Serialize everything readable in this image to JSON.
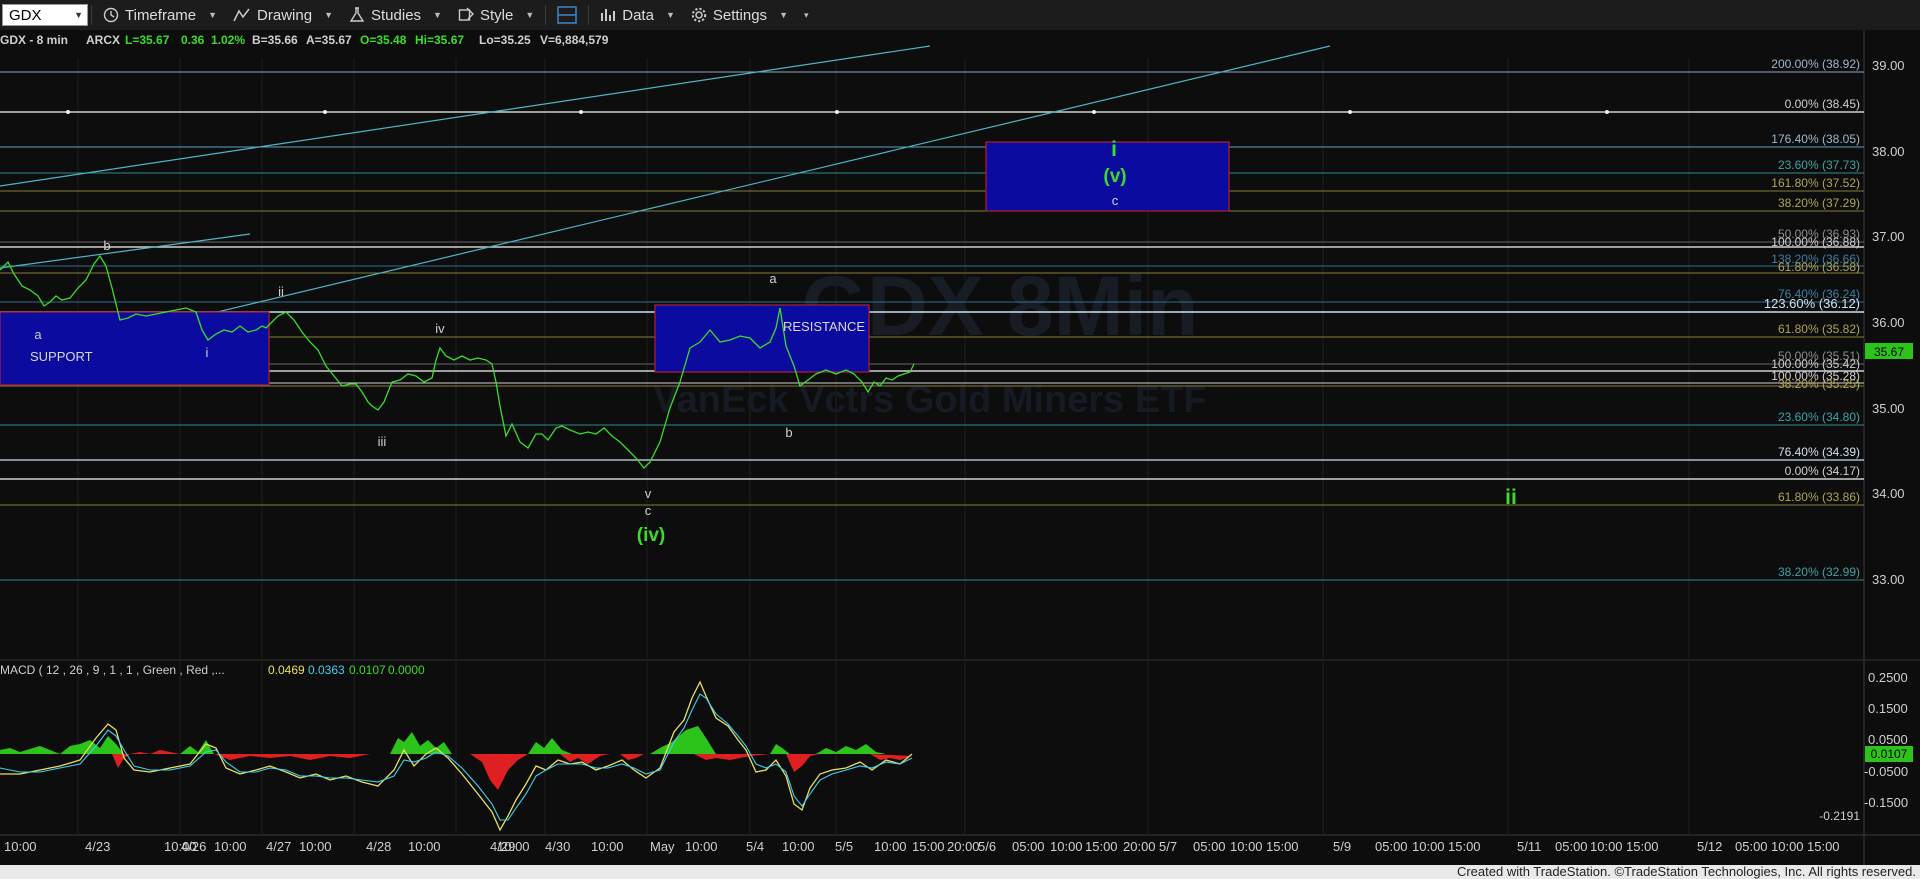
{
  "toolbar": {
    "symbol": "GDX",
    "timeframe": "Timeframe",
    "drawing": "Drawing",
    "studies": "Studies",
    "style": "Style",
    "data": "Data",
    "settings": "Settings"
  },
  "chart_header": {
    "symbol": "GDX - 8 min",
    "exchange": "ARCX",
    "last": "L=35.67",
    "change": "0.36",
    "change_pct": "1.02%",
    "bid": "B=35.66",
    "ask": "A=35.67",
    "open": "O=35.48",
    "high": "Hi=35.67",
    "low": "Lo=35.25",
    "volume": "V=6,884,579"
  },
  "watermark": {
    "line1": "GDX 8Min",
    "line2": "VanEck Vctrs Gold Miners ETF"
  },
  "price_axis": {
    "ticks": [
      "39.00",
      "38.00",
      "37.00",
      "36.00",
      "35.00",
      "34.00",
      "33.00"
    ],
    "current_price": "35.67"
  },
  "fib_labels": [
    {
      "text": "200.00% (38.92)",
      "color": "#9fb6cc"
    },
    {
      "text": "0.00% (38.45)",
      "color": "#cfcfcf"
    },
    {
      "text": "176.40% (38.05)",
      "color": "#9fb6cc"
    },
    {
      "text": "23.60% (37.73)",
      "color": "#3fa3a3"
    },
    {
      "text": "161.80% (37.52)",
      "color": "#b0a552"
    },
    {
      "text": "38.20% (37.29)",
      "color": "#b0a552"
    },
    {
      "text": "50.00% (36.93)",
      "color": "#8c8c8c"
    },
    {
      "text": "100.00% (36.88)",
      "color": "#cfcfcf"
    },
    {
      "text": "138.20% (36.66)",
      "color": "#3f7fa0"
    },
    {
      "text": "61.80% (36.58)",
      "color": "#b0a552"
    },
    {
      "text": "76.40% (36.24)",
      "color": "#3f7fa0"
    },
    {
      "text": "123.60% (36.12)",
      "color": "#cfe0ee"
    },
    {
      "text": "61.80% (35.82)",
      "color": "#b0a552"
    },
    {
      "text": "50.00% (35.51)",
      "color": "#8c8c8c"
    },
    {
      "text": "100.00% (35.42)",
      "color": "#cfcfcf"
    },
    {
      "text": "100.00% (35.28)",
      "color": "#cfcfcf"
    },
    {
      "text": "38.20% (35.25)",
      "color": "#b0a552"
    },
    {
      "text": "23.60% (34.80)",
      "color": "#3fa3a3"
    },
    {
      "text": "76.40% (34.39)",
      "color": "#cfe0ee"
    },
    {
      "text": "0.00% (34.17)",
      "color": "#cfcfcf"
    },
    {
      "text": "61.80% (33.86)",
      "color": "#b0a552"
    },
    {
      "text": "38.20% (32.99)",
      "color": "#3fa3a3"
    }
  ],
  "boxes": {
    "support": "SUPPORT",
    "resistance": "RESISTANCE"
  },
  "wave_labels": {
    "a1": "a",
    "b1": "b",
    "i_small": "i",
    "ii_small": "ii",
    "iii_small": "iii",
    "iv_small": "iv",
    "v_small": "v",
    "c1": "c",
    "iv_paren": "(iv)",
    "a2": "a",
    "b2": "b",
    "i_big": "i",
    "v_paren": "(v)",
    "c2": "c",
    "ii_big": "ii"
  },
  "macd": {
    "label": "MACD ( 12 , 26 , 9 , 1 , 1 , Green , Red ,...",
    "v1": "0.0469",
    "v2": "0.0363",
    "v3": "0.0107",
    "v4": "0.0000",
    "ticks": [
      "0.2500",
      "0.1500",
      "0.0500",
      "-0.0500",
      "-0.1500"
    ],
    "current": "0.0107",
    "low_label": "-0.2191"
  },
  "time_axis": [
    "10:00",
    "4/23",
    "10:00",
    "4/26",
    "10:00",
    "4/27",
    "10:00",
    "4/28",
    "10:00",
    "4/29",
    "10:00",
    "4/30",
    "10:00",
    "May",
    "10:00",
    "5/4",
    "10:00",
    "5/5",
    "10:00",
    "15:00",
    "20:00",
    "5/6",
    "05:00",
    "10:00",
    "15:00",
    "20:00",
    "5/7",
    "05:00",
    "10:00",
    "15:00",
    "5/9",
    "05:00",
    "10:00",
    "15:00",
    "5/11",
    "05:00",
    "10:00",
    "15:00",
    "5/12",
    "05:00",
    "10:00",
    "15:00"
  ],
  "footer": "Created with TradeStation. ©TradeStation Technologies, Inc. All rights reserved."
}
